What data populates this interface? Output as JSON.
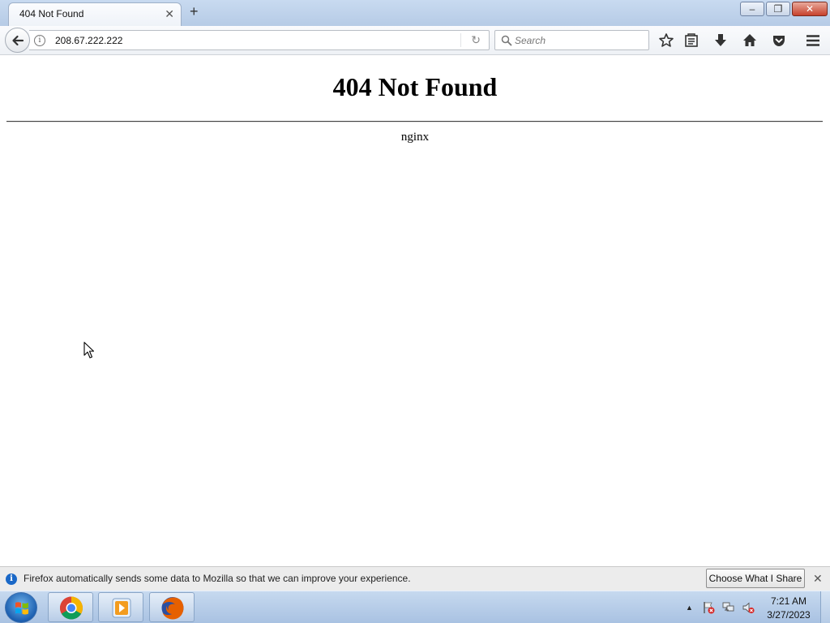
{
  "browser": {
    "tab": {
      "title": "404 Not Found",
      "close_icon": "close-icon"
    },
    "new_tab_icon": "plus-icon",
    "window_controls": [
      "minimize-icon",
      "restore-icon",
      "close-icon"
    ],
    "toolbar": {
      "url": "208.67.222.222",
      "search_placeholder": "Search",
      "icons": [
        "bookmark-star-icon",
        "reading-list-icon",
        "download-icon",
        "home-icon",
        "pocket-icon",
        "menu-icon"
      ]
    }
  },
  "page": {
    "heading": "404 Not Found",
    "server": "nginx"
  },
  "notification": {
    "text": "Firefox automatically sends some data to Mozilla so that we can improve your experience.",
    "button": "Choose What I Share"
  },
  "taskbar": {
    "apps": [
      "chrome",
      "media-player",
      "firefox"
    ],
    "clock": {
      "time": "7:21 AM",
      "date": "3/27/2023"
    }
  },
  "colors": {
    "accent": "#1a68c7",
    "taskbar": "#b6cce8"
  }
}
